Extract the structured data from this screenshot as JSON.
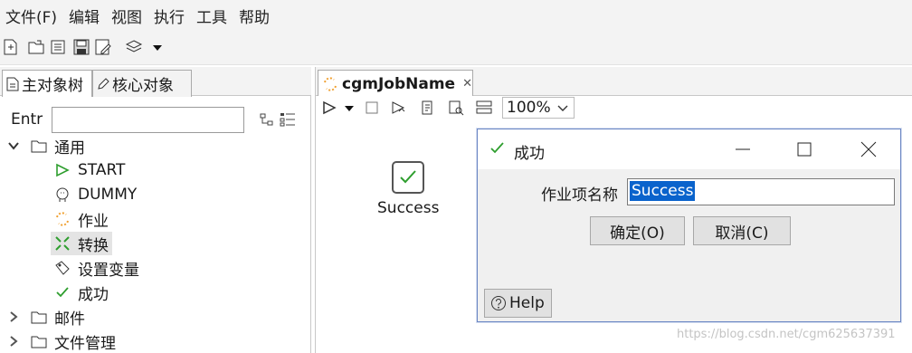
{
  "menubar": {
    "items": [
      "文件(F)",
      "编辑",
      "视图",
      "执行",
      "工具",
      "帮助"
    ]
  },
  "toolbar": {
    "icons": [
      "new-file-icon",
      "open-folder-icon",
      "properties-icon",
      "save-icon",
      "save-as-icon",
      "layers-icon",
      "dropdown-arrow-icon"
    ]
  },
  "left_panel": {
    "tabs": [
      {
        "label": "主对象树",
        "icon": "document-icon"
      },
      {
        "label": "核心对象",
        "icon": "pencil-icon"
      }
    ],
    "filter_label": "Entr",
    "filter_value": "",
    "tree": {
      "general": "通用",
      "items": [
        {
          "label": "START",
          "icon": "play-icon"
        },
        {
          "label": "DUMMY",
          "icon": "dummy-icon"
        },
        {
          "label": "作业",
          "icon": "job-icon"
        },
        {
          "label": "转换",
          "icon": "transform-icon"
        },
        {
          "label": "设置变量",
          "icon": "set-variable-icon"
        },
        {
          "label": "成功",
          "icon": "check-icon"
        }
      ],
      "mail": "邮件",
      "file_mgmt": "文件管理"
    }
  },
  "editor": {
    "tab_title": "cgmJobName",
    "zoom": "100%",
    "node_label": "Success"
  },
  "dialog": {
    "title": "成功",
    "field_label": "作业项名称",
    "field_value": "Success",
    "ok_label": "确定(O)",
    "cancel_label": "取消(C)",
    "help_label": "Help"
  },
  "watermark": "https://blog.csdn.net/cgm625637391",
  "colors": {
    "accent_blue": "#0a63cc",
    "success_green": "#2e9e2e",
    "job_orange": "#f0a030"
  }
}
